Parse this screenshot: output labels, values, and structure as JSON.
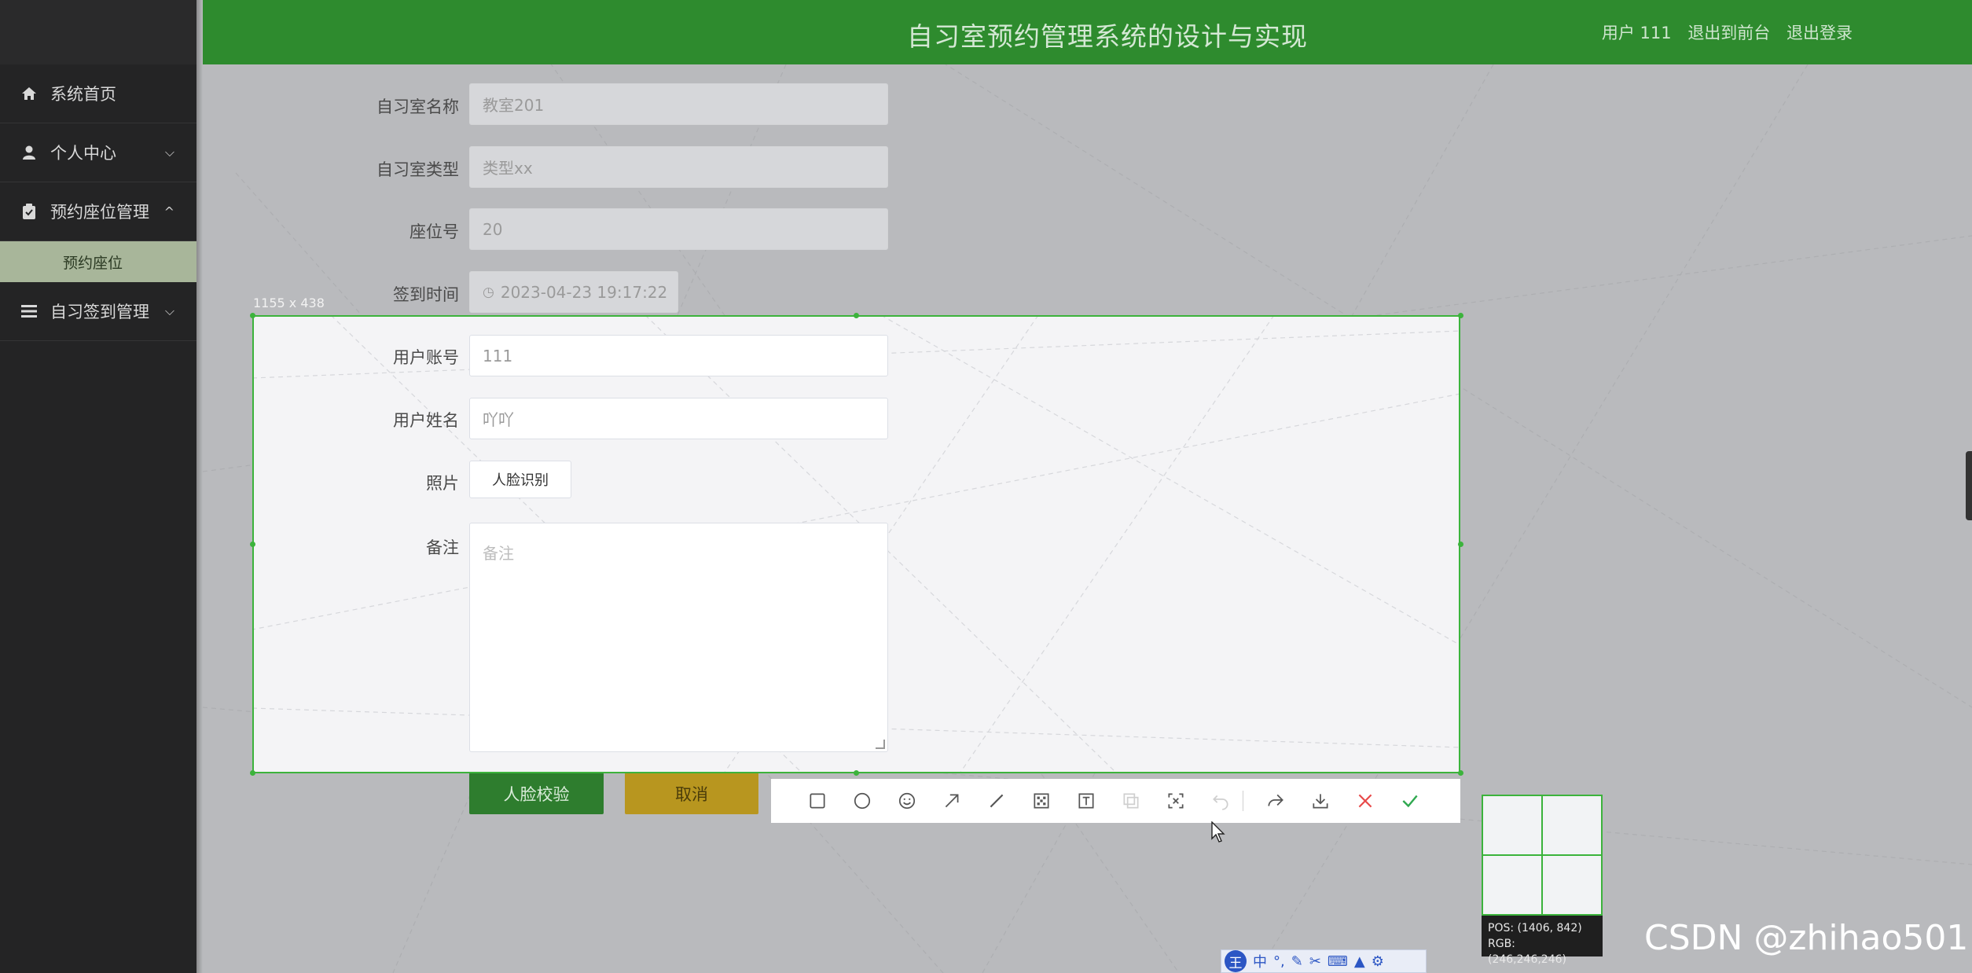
{
  "header": {
    "title": "自习室预约管理系统的设计与实现",
    "user": "用户 111",
    "to_front": "退出到前台",
    "logout": "退出登录"
  },
  "sidebar": {
    "items": [
      {
        "label": "系统首页",
        "icon": "home-icon"
      },
      {
        "label": "个人中心",
        "icon": "user-icon",
        "chevron": "down"
      },
      {
        "label": "预约座位管理",
        "icon": "clipboard-icon",
        "chevron": "up"
      },
      {
        "label": "预约座位",
        "sub": true
      },
      {
        "label": "自习签到管理",
        "icon": "menu-icon",
        "chevron": "down"
      }
    ]
  },
  "form": {
    "room_name": {
      "label": "自习室名称",
      "value": "教室201"
    },
    "room_type": {
      "label": "自习室类型",
      "value": "类型xx"
    },
    "seat_no": {
      "label": "座位号",
      "value": "20"
    },
    "sign_time": {
      "label": "签到时间",
      "value": "2023-04-23 19:17:22"
    },
    "account": {
      "label": "用户账号",
      "value": "111"
    },
    "username": {
      "label": "用户姓名",
      "value": "吖吖"
    },
    "photo": {
      "label": "照片",
      "button": "人脸识别"
    },
    "remark": {
      "label": "备注",
      "placeholder": "备注"
    },
    "verify_button": "人脸校验",
    "cancel_button": "取消"
  },
  "capture": {
    "size_label": "1155 x 438",
    "tools": [
      "rectangle-icon",
      "circle-icon",
      "emoji-icon",
      "arrow-icon",
      "line-icon",
      "mosaic-icon",
      "text-icon",
      "copy-icon",
      "ocr-icon",
      "undo-icon",
      "share-icon",
      "download-icon",
      "close-icon",
      "confirm-icon"
    ],
    "pos": "POS: (1406, 842)",
    "rgb": "RGB: (246,246,246)"
  },
  "ime": {
    "logo": "王",
    "lang": "中"
  },
  "watermark": "CSDN @zhihao501",
  "colors": {
    "header": "#2e8b2e",
    "sidebar": "#242425",
    "selection": "#3cb33c",
    "cancel": "#b8961f"
  }
}
